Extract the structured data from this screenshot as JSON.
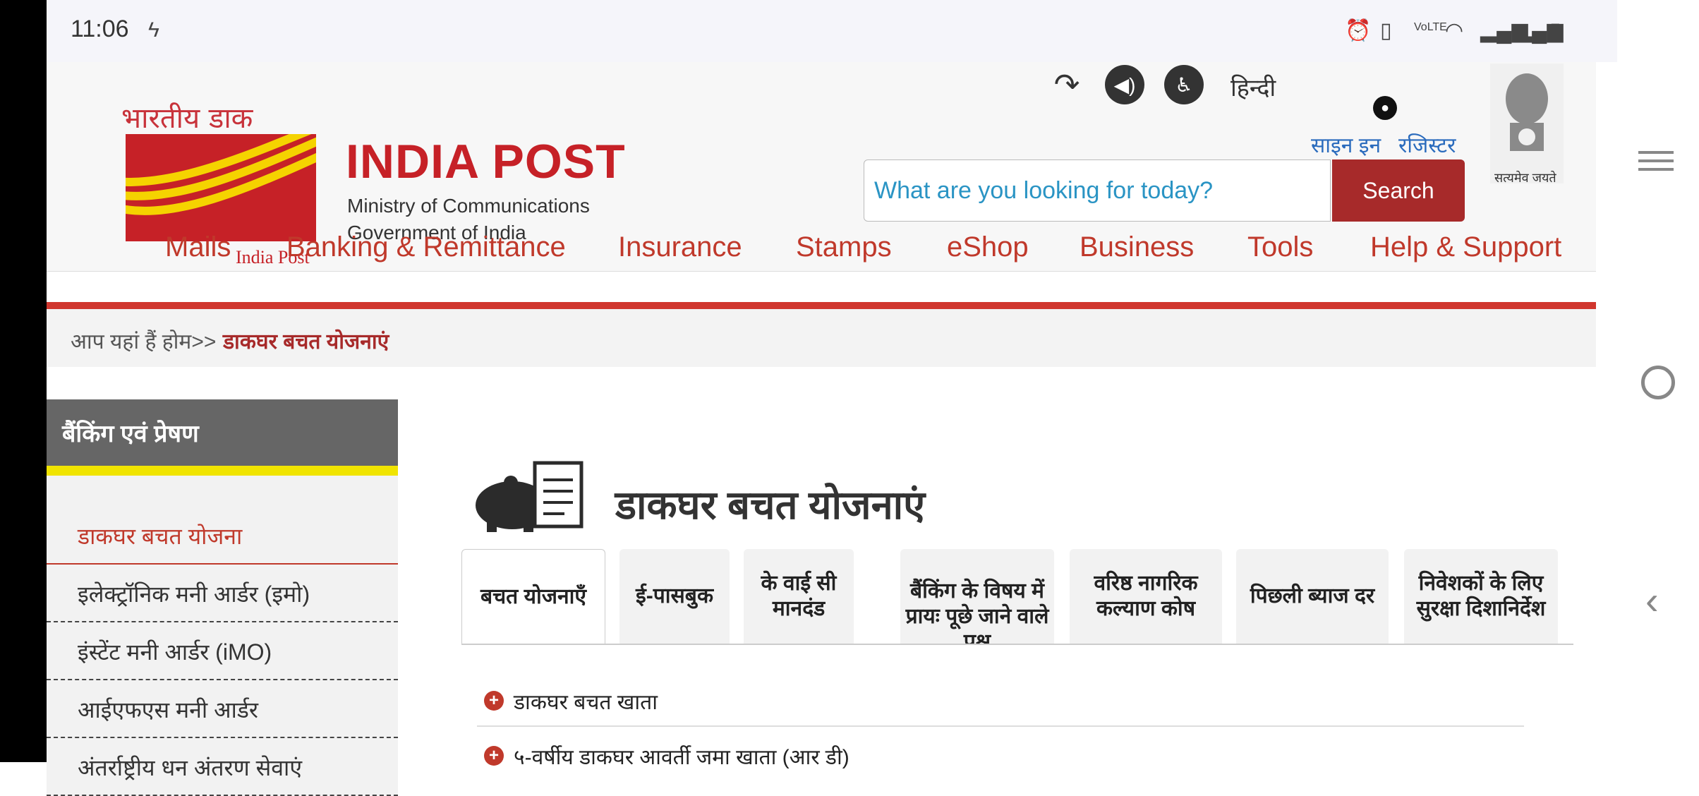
{
  "status_bar": {
    "time": "11:06",
    "icons": [
      "alarm-icon",
      "vibrate-icon",
      "volte-icon",
      "wifi-icon",
      "signal-icon",
      "signal-icon",
      "battery-icon"
    ]
  },
  "header": {
    "logo_hindi": "भारतीय डाक",
    "logo_name": "INDIA POST",
    "logo_ministry": "Ministry of Communications",
    "logo_govt": "Government of India",
    "logo_india_post": "India Post",
    "language_link": "हिन्दी",
    "signin_label": "साइन इन",
    "register_label": "रजिस्टर",
    "emblem_caption": "सत्यमेव जयते",
    "search": {
      "placeholder": "What are you looking for today?",
      "button_label": "Search"
    }
  },
  "nav": {
    "items": [
      "Mails",
      "Banking & Remittance",
      "Insurance",
      "Stamps",
      "eShop",
      "Business",
      "Tools",
      "Help & Support"
    ]
  },
  "breadcrumb": {
    "prefix": "आप यहां हैं होम>>",
    "current": "डाकघर बचत योजनाएं"
  },
  "sidebar": {
    "title": "बैंकिंग एवं प्रेषण",
    "items": [
      {
        "label": "डाकघर बचत योजना",
        "active": true
      },
      {
        "label": "इलेक्ट्रॉनिक मनी आर्डर (इमो)"
      },
      {
        "label": "इंस्टेंट मनी आर्डर (iMO)"
      },
      {
        "label": "आईएफएस मनी आर्डर"
      },
      {
        "label": "अंतर्राष्ट्रीय धन अंतरण सेवाएं"
      }
    ]
  },
  "main": {
    "title": "डाकघर बचत योजनाएं",
    "tabs": [
      {
        "label": "बचत योजनाएँ",
        "active": true
      },
      {
        "label": "ई-पासबुक"
      },
      {
        "label": "के वाई सी मानदंड"
      },
      {
        "label": "बैंकिंग के विषय में प्रायः पूछे जाने वाले प्रश्न"
      },
      {
        "label": "वरिष्ठ नागरिक कल्याण कोष"
      },
      {
        "label": "पिछली ब्याज दर"
      },
      {
        "label": "निवेशकों के लिए सुरक्षा दिशानिर्देश"
      }
    ],
    "accordion": [
      {
        "label": "डाकघर बचत खाता"
      },
      {
        "label": "५-वर्षीय डाकघर आवर्ती जमा खाता (आर डी)"
      }
    ]
  },
  "colors": {
    "brand_red": "#c62127",
    "nav_red": "#c0392b",
    "link_blue": "#2a6bbd",
    "sidebar_yellow": "#f0e400"
  }
}
